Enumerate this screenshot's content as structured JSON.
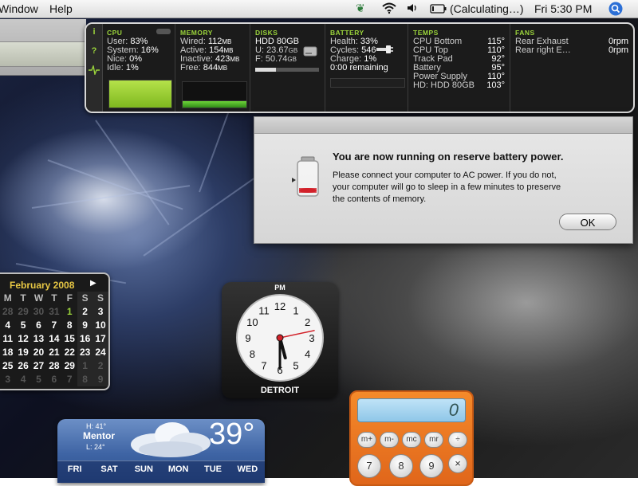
{
  "menubar": {
    "menus": [
      "Window",
      "Help"
    ],
    "battery_status": "(Calculating…)",
    "clock": "Fri 5:30 PM"
  },
  "istat": {
    "side_buttons": [
      "i",
      "?"
    ],
    "cpu": {
      "title": "CPU",
      "rows": [
        {
          "label": "User:",
          "value": "83%"
        },
        {
          "label": "System:",
          "value": "16%"
        },
        {
          "label": "Nice:",
          "value": "0%"
        },
        {
          "label": "Idle:",
          "value": "1%"
        }
      ],
      "usage_fraction": 0.99
    },
    "memory": {
      "title": "MEMORY",
      "rows": [
        {
          "label": "Wired:",
          "value": "112",
          "unit": "MB"
        },
        {
          "label": "Active:",
          "value": "154",
          "unit": "MB"
        },
        {
          "label": "Inactive:",
          "value": "423",
          "unit": "MB"
        },
        {
          "label": "Free:",
          "value": "844",
          "unit": "MB"
        }
      ]
    },
    "disks": {
      "title": "DISKS",
      "name": "HDD 80GB",
      "used_label": "U:",
      "used_value": "23.67",
      "used_unit": "GB",
      "free_label": "F:",
      "free_value": "50.74",
      "free_unit": "GB",
      "used_fraction": 0.32
    },
    "battery": {
      "title": "BATTERY",
      "rows": [
        {
          "label": "Health:",
          "value": "33%"
        },
        {
          "label": "Cycles:",
          "value": "546"
        },
        {
          "label": "Charge:",
          "value": "1%"
        }
      ],
      "remaining": "0:00 remaining"
    },
    "temps": {
      "title": "TEMPS",
      "rows": [
        {
          "label": "CPU Bottom",
          "value": "115°"
        },
        {
          "label": "CPU Top",
          "value": "110°"
        },
        {
          "label": "Track Pad",
          "value": "92°"
        },
        {
          "label": "Battery",
          "value": "95°"
        },
        {
          "label": "Power Supply",
          "value": "110°"
        },
        {
          "label": "HD: HDD 80GB",
          "value": "103°"
        }
      ]
    },
    "fans": {
      "title": "FANS",
      "rows": [
        {
          "label": "Rear Exhaust",
          "value": "0rpm"
        },
        {
          "label": "Rear right E…",
          "value": "0rpm"
        }
      ]
    }
  },
  "alert": {
    "heading": "You are now running on reserve battery power.",
    "message": "Please connect your computer to AC power. If you do not,\nyour computer will go to sleep in a few minutes to preserve\nthe contents of memory.",
    "ok_label": "OK"
  },
  "calendar": {
    "month": "February 2008",
    "weekdays": [
      "M",
      "T",
      "W",
      "T",
      "F",
      "S",
      "S"
    ],
    "weeks": [
      [
        {
          "d": "28",
          "dim": true
        },
        {
          "d": "29",
          "dim": true
        },
        {
          "d": "30",
          "dim": true
        },
        {
          "d": "31",
          "dim": true
        },
        {
          "d": "1",
          "today": true
        },
        {
          "d": "2"
        },
        {
          "d": "3"
        }
      ],
      [
        {
          "d": "4"
        },
        {
          "d": "5"
        },
        {
          "d": "6"
        },
        {
          "d": "7"
        },
        {
          "d": "8"
        },
        {
          "d": "9"
        },
        {
          "d": "10"
        }
      ],
      [
        {
          "d": "11"
        },
        {
          "d": "12"
        },
        {
          "d": "13"
        },
        {
          "d": "14"
        },
        {
          "d": "15"
        },
        {
          "d": "16"
        },
        {
          "d": "17"
        }
      ],
      [
        {
          "d": "18"
        },
        {
          "d": "19"
        },
        {
          "d": "20"
        },
        {
          "d": "21"
        },
        {
          "d": "22"
        },
        {
          "d": "23"
        },
        {
          "d": "24"
        }
      ],
      [
        {
          "d": "25"
        },
        {
          "d": "26"
        },
        {
          "d": "27"
        },
        {
          "d": "28"
        },
        {
          "d": "29"
        },
        {
          "d": "1",
          "dim": true
        },
        {
          "d": "2",
          "dim": true
        }
      ],
      [
        {
          "d": "3",
          "dim": true
        },
        {
          "d": "4",
          "dim": true
        },
        {
          "d": "5",
          "dim": true
        },
        {
          "d": "6",
          "dim": true
        },
        {
          "d": "7",
          "dim": true
        },
        {
          "d": "8",
          "dim": true
        },
        {
          "d": "9",
          "dim": true
        }
      ]
    ]
  },
  "clock_widget": {
    "ampm": "PM",
    "city": "DETROIT",
    "hour": 5,
    "minute": 30,
    "second": 13,
    "numbers": [
      "12",
      "1",
      "2",
      "3",
      "4",
      "5",
      "6",
      "7",
      "8",
      "9",
      "10",
      "11"
    ]
  },
  "calculator": {
    "display": "0",
    "row1": [
      "m+",
      "m-",
      "mc",
      "mr",
      "÷"
    ],
    "row2": [
      "7",
      "8",
      "9",
      "×"
    ]
  },
  "weather": {
    "city": "Mentor",
    "high": "H: 41°",
    "low": "L: 24°",
    "temp": "39°",
    "days": [
      "FRI",
      "SAT",
      "SUN",
      "MON",
      "TUE",
      "WED"
    ]
  },
  "colors": {
    "istat_accent": "#9ad33b",
    "calendar_month": "#e7c744",
    "calculator_body": "#f07a22"
  }
}
